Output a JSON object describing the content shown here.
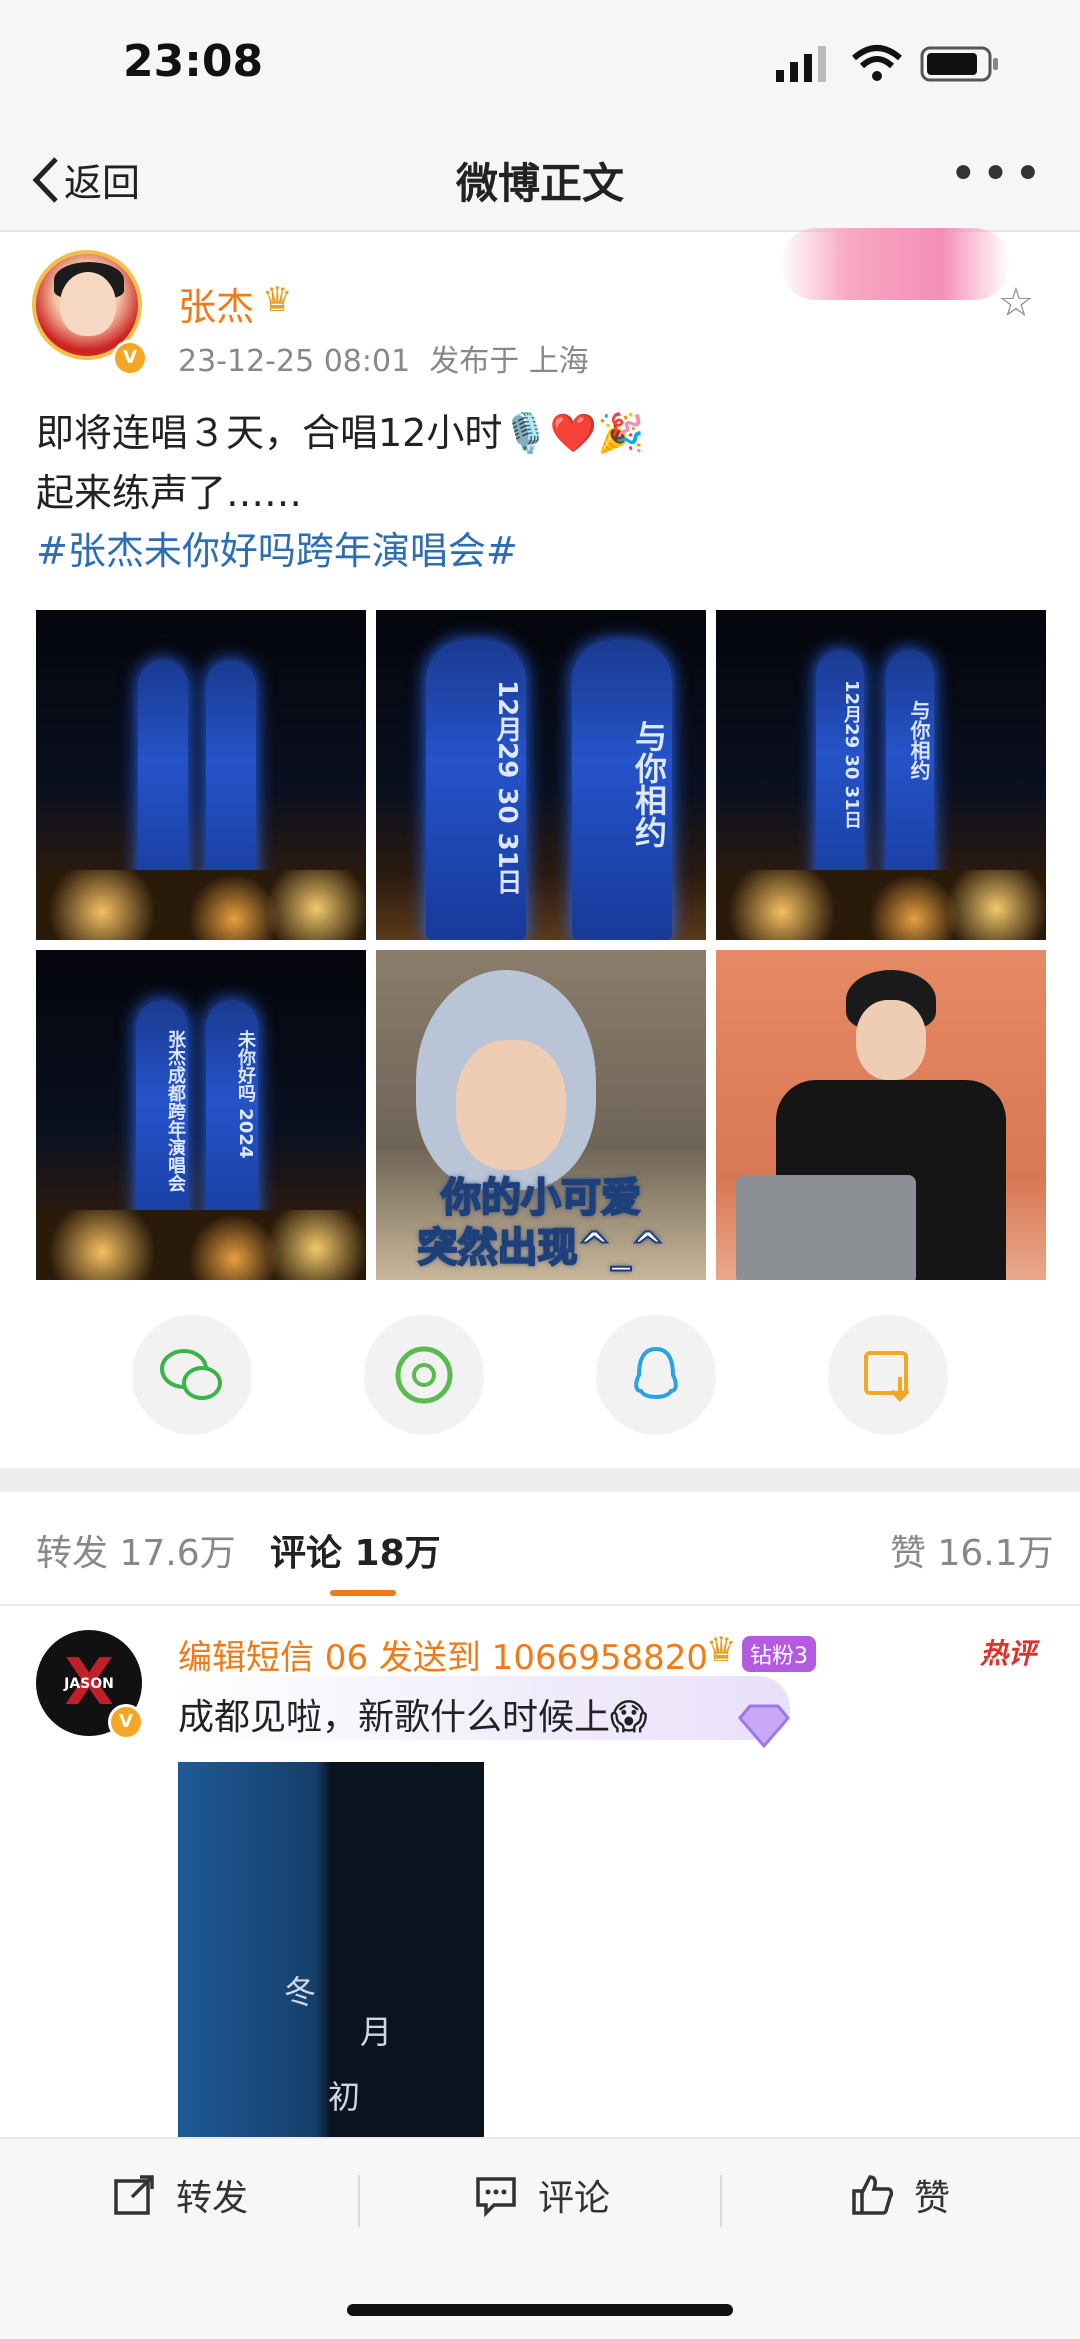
{
  "status_bar": {
    "time": "23:08"
  },
  "nav": {
    "back_label": "返回",
    "title": "微博正文",
    "more_label": "•••"
  },
  "post": {
    "author": "张杰",
    "timestamp": "23-12-25 08:01",
    "location_prefix": "发布于",
    "location": "上海",
    "line1": "即将连唱３天，合唱12小时🎙️❤️🎉",
    "line2": "起来练声了……",
    "hashtag": "#张杰未你好吗跨年演唱会#",
    "photos": [
      {
        "name": "photo-1",
        "overlay": ""
      },
      {
        "name": "photo-2",
        "overlay_left": "12月29 30 31日",
        "overlay_right": "与你相约"
      },
      {
        "name": "photo-3",
        "overlay_left": "12月29 30 31日",
        "overlay_right": "与你相约"
      },
      {
        "name": "photo-4",
        "overlay_left": "张杰成都跨年演唱会",
        "overlay_right": "未你好吗 2024"
      },
      {
        "name": "photo-5",
        "caption_line1": "你的小可爱",
        "caption_line2": "突然出现^_^"
      },
      {
        "name": "photo-6",
        "overlay": ""
      }
    ]
  },
  "share": {
    "icons": [
      "wechat-icon",
      "moments-icon",
      "qq-icon",
      "save-image-icon"
    ]
  },
  "tabs": {
    "repost": "转发 17.6万",
    "comment": "评论 18万",
    "like": "赞 16.1万"
  },
  "comment": {
    "user": "编辑短信 06 发送到 1066958820",
    "fan_badge": "钻粉3",
    "hot_tag": "热评",
    "text": "成都见啦，新歌什么时候上😱",
    "avatar_text": "JASON",
    "image_text": [
      "冬",
      "月",
      "初"
    ]
  },
  "bottom_bar": {
    "repost": "转发",
    "comment": "评论",
    "like": "赞"
  },
  "colors": {
    "accent": "#f07a16",
    "link": "#2c6db3",
    "hot": "#e0302b"
  }
}
